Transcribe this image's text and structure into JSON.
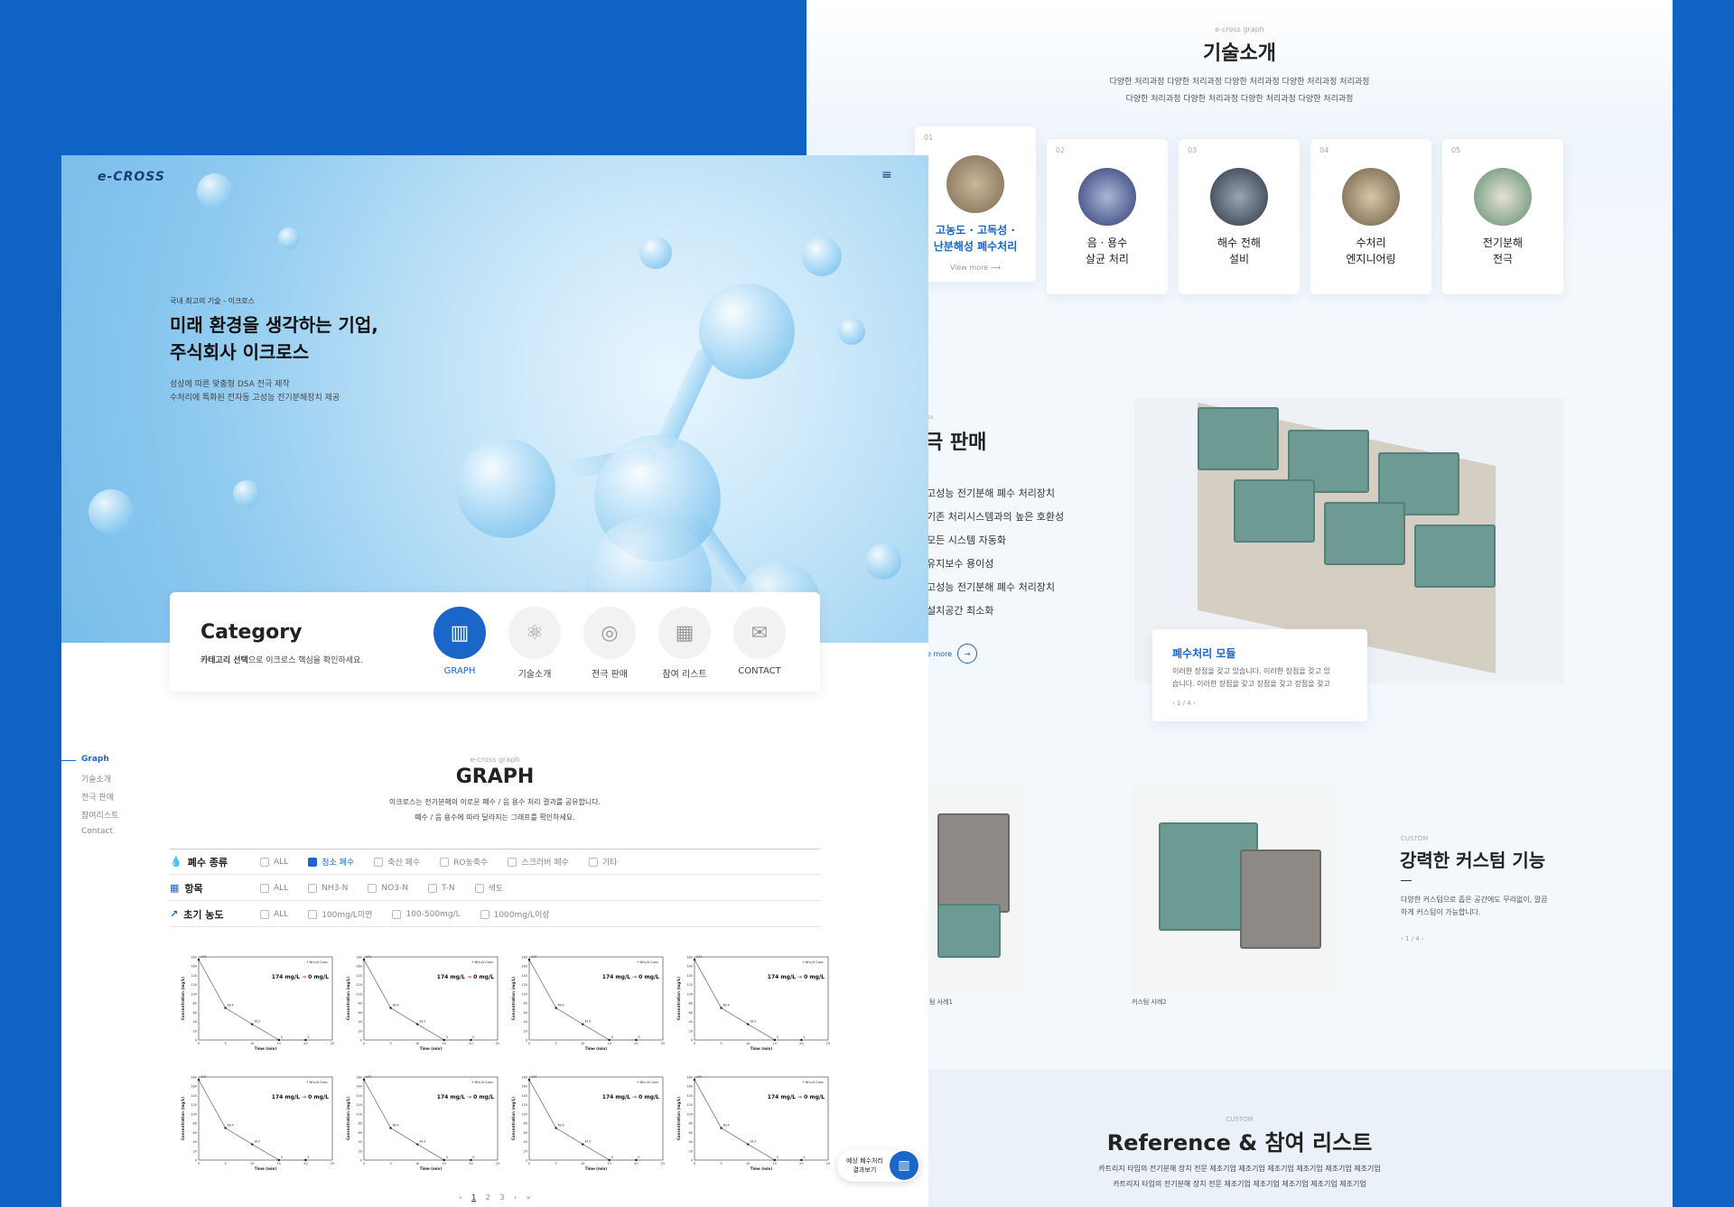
{
  "colors": {
    "brand": "#0f63c4",
    "accent": "#1a66c9",
    "bg": "#f3f8fd"
  },
  "header": {
    "logo": "e-CROSS",
    "menu_icon": "hamburger-icon"
  },
  "hero": {
    "eyebrow": "국내 최고의 기술 - 이크로스",
    "title_line1": "미래 환경을 생각하는 기업,",
    "title_line2": "주식회사 이크로스",
    "desc_line1": "성상에 따른 맞춤형 DSA 전극 제작",
    "desc_line2": "수처리에 특화된 전자동 고성능 전기분해장치 제공"
  },
  "category": {
    "title": "Category",
    "subtitle_bold": "카테고리 선택",
    "subtitle_rest": "으로 이크로스 핵심을 확인하세요.",
    "items": [
      {
        "label": "GRAPH",
        "icon": "graph-icon",
        "active": true
      },
      {
        "label": "기술소개",
        "icon": "atom-icon",
        "active": false
      },
      {
        "label": "전극 판매",
        "icon": "electrode-icon",
        "active": false
      },
      {
        "label": "참여 리스트",
        "icon": "building-icon",
        "active": false
      },
      {
        "label": "CONTACT",
        "icon": "mail-icon",
        "active": false
      }
    ]
  },
  "side_nav": [
    "Graph",
    "기술소개",
    "전극 판매",
    "참여리스트",
    "Contact"
  ],
  "graph": {
    "eyebrow": "e-cross graph",
    "title": "GRAPH",
    "desc_line1": "이크로스는 전기분해의 이로운 폐수 / 음 용수 처리 결과를 공유합니다.",
    "desc_line2": "폐수 / 음 용수에 따라 달라지는 그래프를 확인하세요.",
    "filters": [
      {
        "label": "폐수 종류",
        "icon": "drop-icon",
        "options": [
          "ALL",
          "청소 폐수",
          "축산 폐수",
          "RO농축수",
          "스크러버 폐수",
          "기타"
        ],
        "checked": 1
      },
      {
        "label": "항목",
        "icon": "grid-icon",
        "options": [
          "ALL",
          "NH3-N",
          "NO3-N",
          "T-N",
          "색도"
        ],
        "checked": -1
      },
      {
        "label": "초기 농도",
        "icon": "trend-icon",
        "options": [
          "ALL",
          "100mg/L미만",
          "100-500mg/L",
          "1000mg/L이상"
        ],
        "checked": -1
      }
    ],
    "chart_note_before": "174 mg/L",
    "chart_note_arrow": "→",
    "chart_note_after": "0 mg/L",
    "pagination": [
      "‹",
      "1",
      "2",
      "3",
      "›",
      "»"
    ]
  },
  "chart_data": [
    {
      "type": "line",
      "title": "",
      "x": [
        0,
        5,
        10,
        15,
        20
      ],
      "values": [
        174,
        69.4,
        34.2,
        0,
        0
      ],
      "xlabel": "Time (min)",
      "ylabel": "Concentration (mg/L)",
      "ylim": [
        0,
        180
      ],
      "xlim": [
        0,
        25
      ],
      "legend": "NH₃-N Conc."
    }
  ],
  "tech": {
    "eyebrow": "e-cross graph",
    "title": "기술소개",
    "desc_line1": "다양한 처리과정 다양한 처리과정 다양한 처리과정 다양한 처리과정 처리과정",
    "desc_line2": "다양한 처리과정 다양한 처리과정 다양한 처리과정 다양한 처리과정",
    "cards": [
      {
        "num": "01",
        "label": "고농도 · 고독성 ·\n난분해성 폐수처리",
        "more": "View more",
        "active": true
      },
      {
        "num": "02",
        "label": "음 · 용수\n살균 처리",
        "active": false
      },
      {
        "num": "03",
        "label": "해수 전해\n설비",
        "active": false
      },
      {
        "num": "04",
        "label": "수처리\n엔지니어링",
        "active": false
      },
      {
        "num": "05",
        "label": "전기분해\n전극",
        "active": false
      }
    ]
  },
  "electrode": {
    "eyebrow": "ss",
    "title": "극 판매",
    "features": [
      "고성능 전기분해 폐수 처리장치",
      "기존 처리시스템과의 높은 호환성",
      "모든 시스템 자동화",
      "유지보수 용이성",
      "고성능 전기분해 폐수 처리장치",
      "설치공간 최소화"
    ],
    "more": "e more",
    "module_title": "폐수처리 모듈",
    "module_desc_line1": "이러한 장점을 갖고 있습니다. 이러한 장점을 갖고 있",
    "module_desc_line2": "습니다. 이러한 장점을 갖고 장점을 갖고 장점을 갖고",
    "module_pager": "‹ 1 / 4 ›"
  },
  "custom": {
    "eyebrow": "CUSTOM",
    "title": "강력한 커스텀 기능",
    "desc_line1": "다양한 커스텀으로 좁은 공간에도 무리없이, 깔끔",
    "desc_line2": "하게 커스텀이 가능합니다.",
    "pager": "‹ 1 / 4 ›",
    "caption1": "텀 사례1",
    "caption2": "커스텀 사례2"
  },
  "reference": {
    "eyebrow": "CUSTOM",
    "title": "Reference & 참여 리스트",
    "desc_line1": "카트리지 타입의 전기분해 장치 전문 제조기업 제조기업 제조기업 제조기업 제조기업 제조기업",
    "desc_line2": "카트리지 타입의 전기분해 장치 전문 제조기업 제조기업 제조기업 제조기업 제조기업"
  },
  "floating": {
    "line1": "예상 폐수처리",
    "line2": "결과보기"
  }
}
